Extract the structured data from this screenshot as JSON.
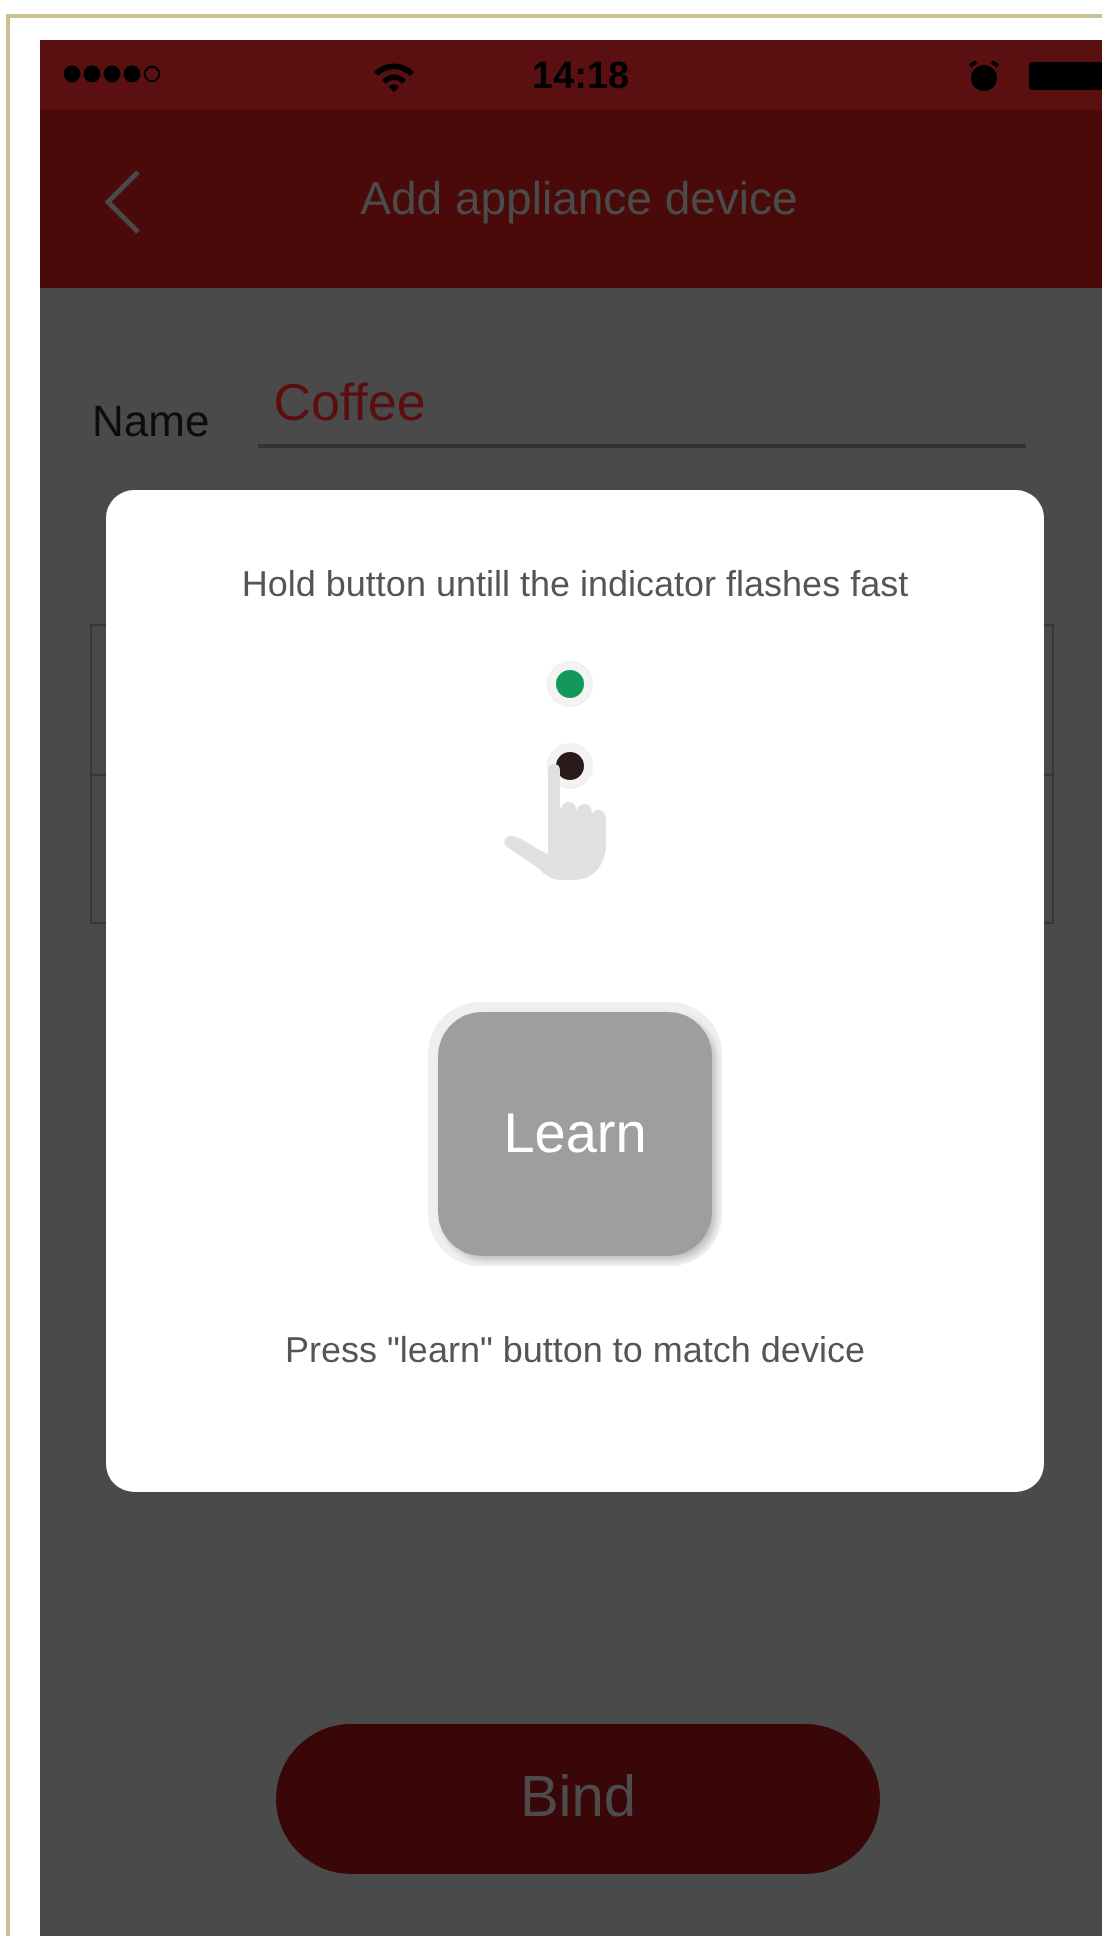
{
  "status_bar": {
    "time": "14:18"
  },
  "nav": {
    "title": "Add appliance device"
  },
  "form": {
    "name_label": "Name",
    "name_value": "Coffee"
  },
  "bind_button": "Bind",
  "dialog": {
    "message": "Hold button untill the indicator flashes fast",
    "indicators": [
      {
        "on": true
      },
      {
        "on": false
      }
    ],
    "learn_button": "Learn",
    "hint": "Press \"learn\" button to match device"
  }
}
